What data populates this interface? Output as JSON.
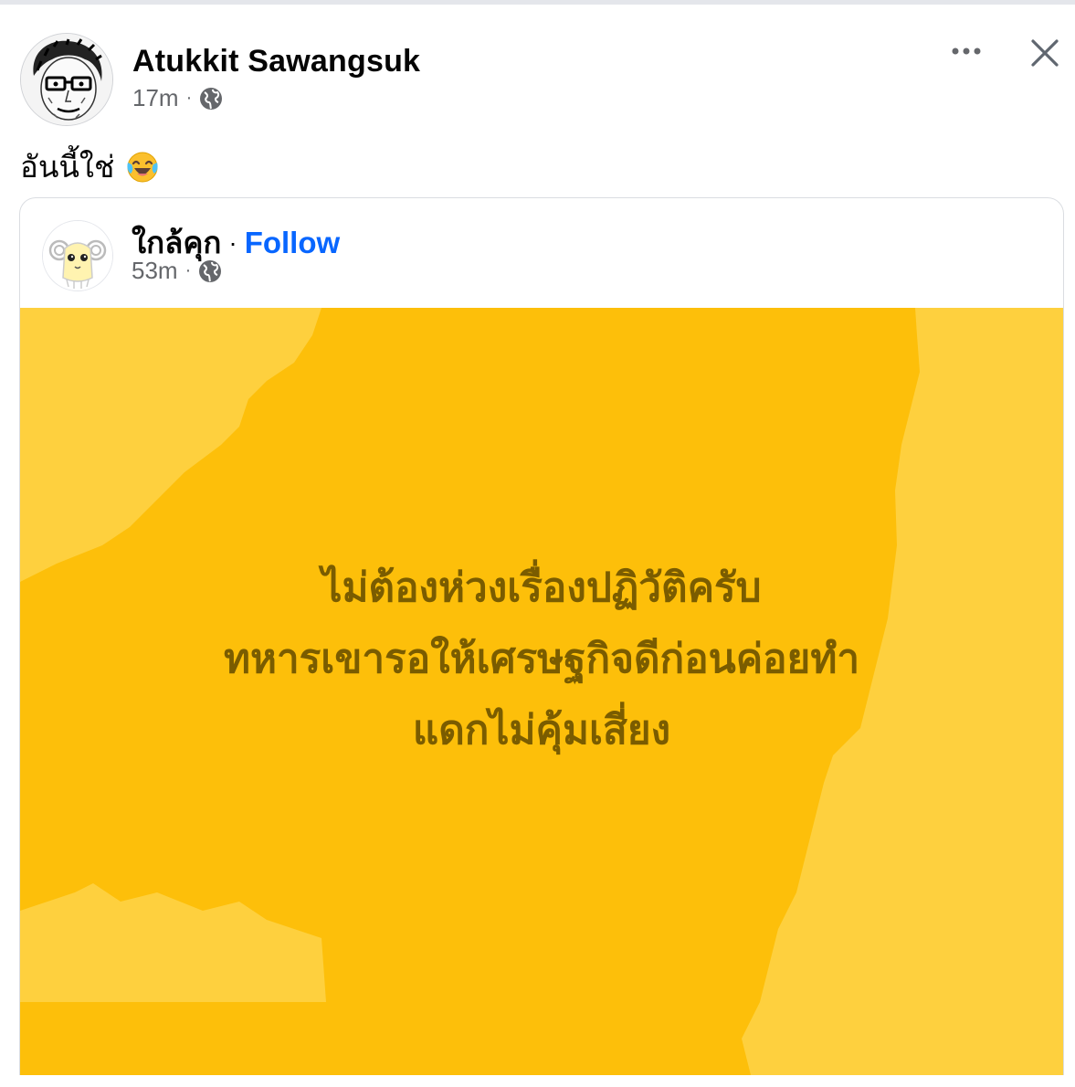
{
  "post": {
    "author_name": "Atukkit Sawangsuk",
    "time": "17m",
    "separator": "·",
    "audience_icon": "globe-icon",
    "text": "อันนี้ใช่",
    "emoji": "face-with-tears-of-joy",
    "more_icon": "more-horizontal-icon",
    "close_icon": "close-icon"
  },
  "shared": {
    "page_name": "ใกล้คุก",
    "separator": "·",
    "follow_label": "Follow",
    "time": "53m",
    "meta_separator": "·",
    "audience_icon": "globe-icon",
    "quote_lines": [
      "ไม่ต้องห่วงเรื่องปฏิวัติครับ",
      "ทหารเขารอให้เศรษฐกิจดีก่อนค่อยทำ",
      "แดกไม่คุ้มเสี่ยง"
    ]
  },
  "colors": {
    "background_yellow": "#fdbf0a",
    "background_light_yellow": "#ffd13f",
    "quote_text": "#7a5c00",
    "follow_blue": "#0866ff",
    "meta_gray": "#65676b"
  }
}
